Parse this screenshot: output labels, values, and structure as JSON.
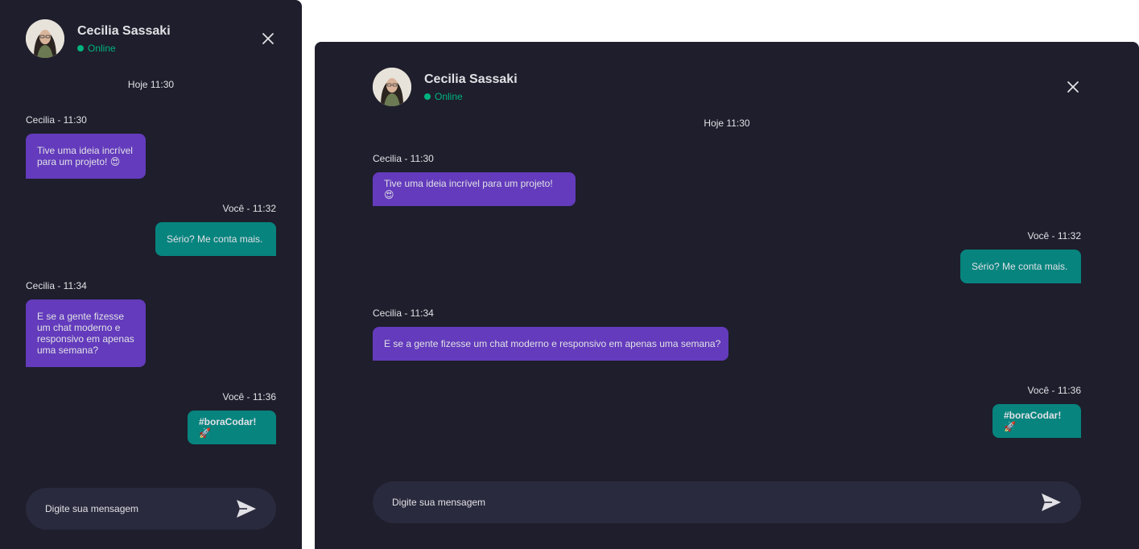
{
  "contact": {
    "name": "Cecilia Sassaki",
    "status": "Online"
  },
  "day_label": "Hoje 11:30",
  "messages": [
    {
      "meta": "Cecilia - 11:30",
      "text": "Tive uma ideia incrível para um projeto! 😍"
    },
    {
      "meta": "Você - 11:32",
      "text": "Sério? Me conta mais."
    },
    {
      "meta": "Cecilia - 11:34",
      "text": "E se a gente fizesse um chat moderno e responsivo em apenas uma semana?"
    },
    {
      "meta": "Você - 11:36",
      "text": "#boraCodar! 🚀"
    }
  ],
  "input": {
    "placeholder": "Digite sua mensagem"
  },
  "colors": {
    "background": "#1e1e2c",
    "incoming": "#633bbc",
    "outgoing": "#07847e",
    "online": "#00b37e",
    "input": "#2a2a3e"
  },
  "icons": {
    "close": "close-icon",
    "send": "send-icon"
  }
}
